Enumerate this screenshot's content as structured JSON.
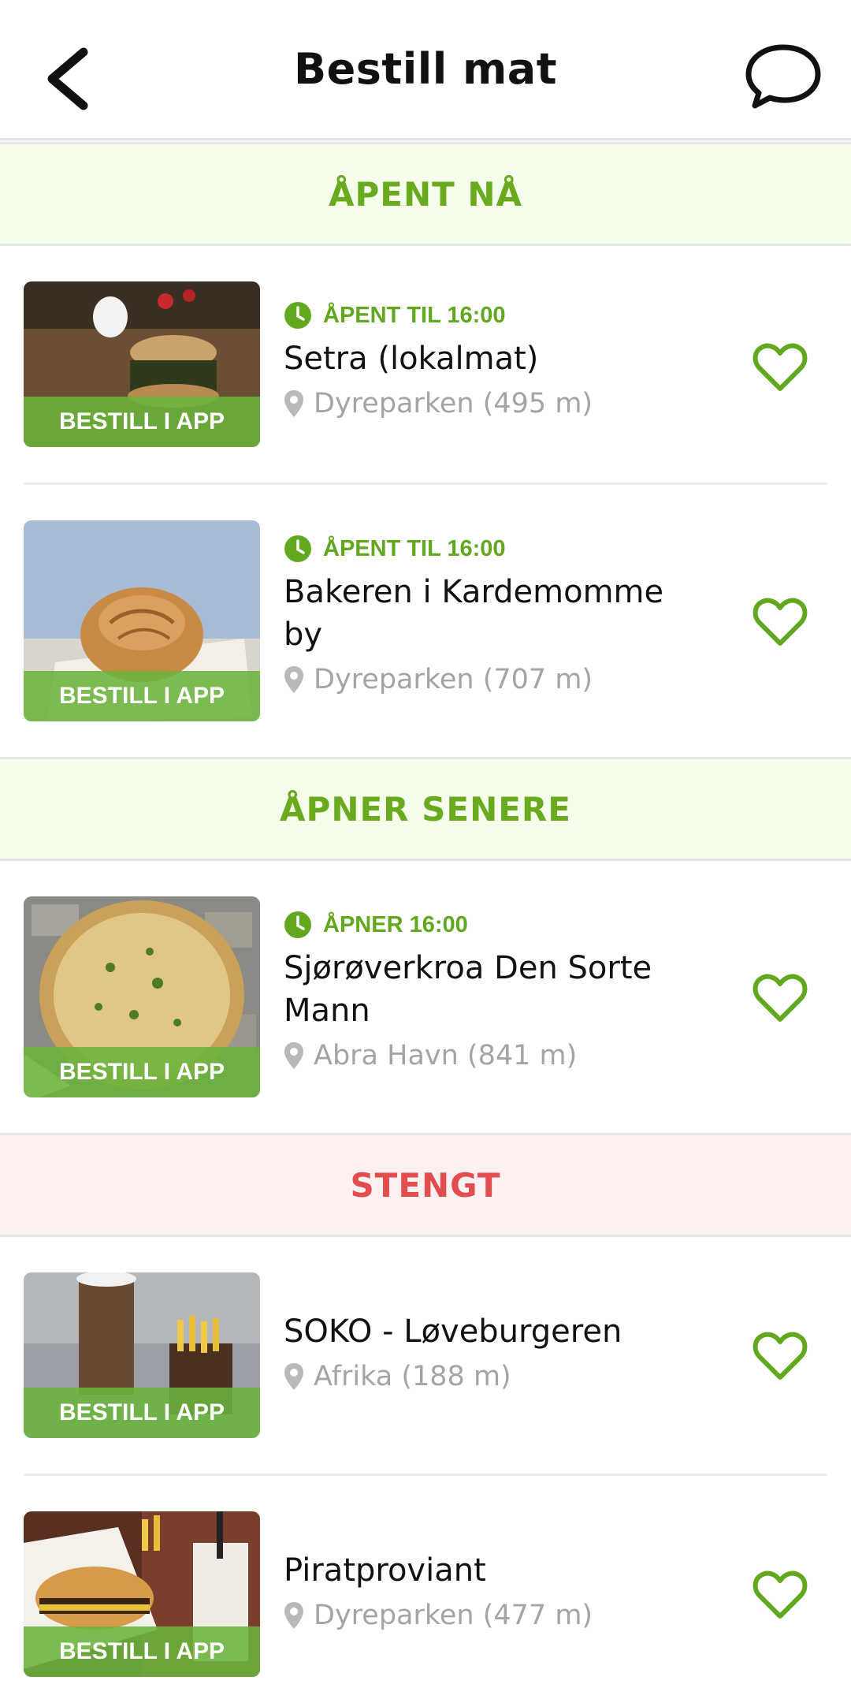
{
  "header": {
    "title": "Bestill mat"
  },
  "icons": {
    "back": "chevron-left-icon",
    "chat": "chat-bubble-icon",
    "clock": "clock-icon",
    "pin": "map-pin-icon",
    "heart": "heart-outline-icon"
  },
  "colors": {
    "accent_green": "#62a81e",
    "closed_red": "#e24d4d",
    "badge_green": "#6ab43c",
    "location_gray": "#a4a4a4"
  },
  "sections": [
    {
      "title": "ÅPENT NÅ",
      "tone": "green",
      "items": [
        {
          "status": "ÅPENT TIL 16:00",
          "name": "Setra (lokalmat)",
          "location": "Dyreparken (495 m)",
          "badge": "BESTILL I APP"
        },
        {
          "status": "ÅPENT TIL 16:00",
          "name": "Bakeren i Kardemomme by",
          "location": "Dyreparken (707 m)",
          "badge": "BESTILL I APP"
        }
      ]
    },
    {
      "title": "ÅPNER SENERE",
      "tone": "green",
      "items": [
        {
          "status": "ÅPNER 16:00",
          "name": "Sjørøverkroa Den Sorte Mann",
          "location": "Abra Havn (841 m)",
          "badge": "BESTILL I APP"
        }
      ]
    },
    {
      "title": "STENGT",
      "tone": "red",
      "items": [
        {
          "status": "",
          "name": "SOKO - Løveburgeren",
          "location": "Afrika (188 m)",
          "badge": "BESTILL I APP"
        },
        {
          "status": "",
          "name": "Piratproviant",
          "location": "Dyreparken (477 m)",
          "badge": "BESTILL I APP"
        }
      ]
    }
  ]
}
